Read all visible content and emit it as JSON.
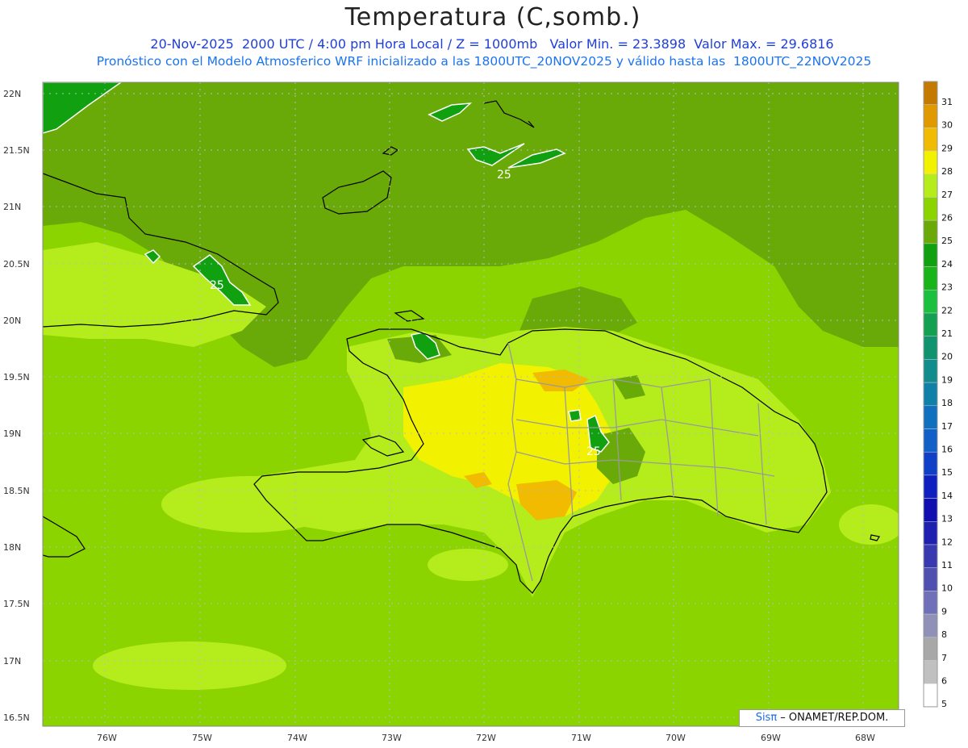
{
  "header": {
    "title": "Temperatura (C,somb.)",
    "date_line": "20-Nov-2025  2000 UTC / 4:00 pm Hora Local / Z = 1000mb   Valor Min. = 23.3898  Valor Max. = 29.6816",
    "model_line": "Pronóstico con el Modelo Atmosferico WRF inicializado a las 1800UTC_20NOV2025 y válido hasta las  1800UTC_22NOV2025"
  },
  "map": {
    "lat_labels": [
      "22N",
      "21.5N",
      "21N",
      "20.5N",
      "20N",
      "19.5N",
      "19N",
      "18.5N",
      "18N",
      "17.5N",
      "17N",
      "16.5N"
    ],
    "lon_labels": [
      "76W",
      "75W",
      "74W",
      "73W",
      "72W",
      "71W",
      "70W",
      "69W",
      "68W"
    ],
    "contour_labels": [
      "25",
      "25",
      "25"
    ],
    "colors": {
      "ocean_dark": "#6aaa08",
      "base": "#8cd400",
      "light": "#b4ec1c",
      "yellow": "#f2f200",
      "orange": "#f0bb00",
      "green_cool": "#1cb424"
    }
  },
  "colorbar": {
    "labels": [
      "31",
      "30",
      "29",
      "28",
      "27",
      "26",
      "25",
      "24",
      "23",
      "22",
      "21",
      "20",
      "19",
      "18",
      "17",
      "16",
      "15",
      "14",
      "13",
      "12",
      "11",
      "10",
      "9",
      "8",
      "7",
      "6",
      "5"
    ],
    "colors": [
      "#c47a00",
      "#e09a00",
      "#f0bb00",
      "#f2f200",
      "#b4ec1c",
      "#8cd400",
      "#6aaa08",
      "#10a010",
      "#18b418",
      "#1cc040",
      "#14a050",
      "#109470",
      "#108c8c",
      "#1080a8",
      "#1070c0",
      "#1060c8",
      "#1040c8",
      "#1020c0",
      "#1010b0",
      "#2020b0",
      "#3838b0",
      "#5050b0",
      "#7070b8",
      "#9090b8",
      "#a8a8a8",
      "#c0c0c0",
      "#ffffff"
    ]
  },
  "credit": {
    "brand": "Sisπ",
    "text": " – ONAMET/REP.DOM."
  }
}
